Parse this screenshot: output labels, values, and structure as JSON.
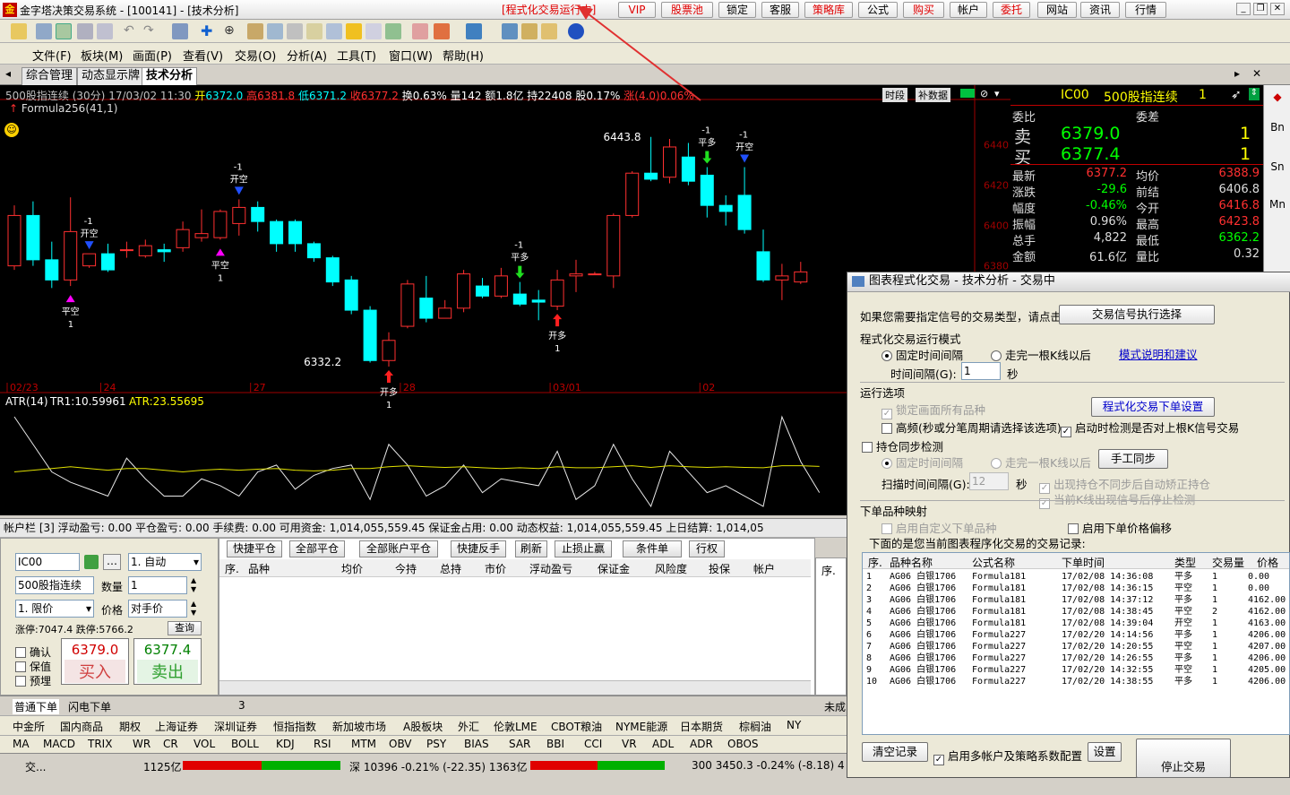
{
  "window": {
    "title": "金字塔决策交易系统 - [100141] - [技术分析]",
    "run_status": "[程式化交易运行中]",
    "app_icon": "金"
  },
  "top_buttons": [
    {
      "label": "VIP",
      "red": true
    },
    {
      "label": "股票池",
      "red": true
    },
    {
      "label": "锁定",
      "red": false
    },
    {
      "label": "客服",
      "red": false
    },
    {
      "label": "策略库",
      "red": true
    },
    {
      "label": "公式",
      "red": false
    },
    {
      "label": "购买",
      "red": true
    },
    {
      "label": "帐户",
      "red": false
    },
    {
      "label": "委托",
      "red": true
    },
    {
      "label": "网站",
      "red": false
    },
    {
      "label": "资讯",
      "red": false
    },
    {
      "label": "行情",
      "red": false
    }
  ],
  "menu": [
    "文件(F)",
    "板块(M)",
    "画面(P)",
    "查看(V)",
    "交易(O)",
    "分析(A)",
    "工具(T)",
    "窗口(W)",
    "帮助(H)"
  ],
  "tabs": [
    "综合管理",
    "动态显示牌",
    "技术分析"
  ],
  "chart_info": {
    "name": "500股指连续 (30分)",
    "date": "17/03/02 11:30",
    "open_label": "开",
    "open": "6372.0",
    "high_label": "高",
    "high": "6381.8",
    "low_label": "低",
    "low": "6371.2",
    "close_label": "收",
    "close": "6377.2",
    "turnover": "换0.63%",
    "volume": "量142",
    "amount": "额1.8亿",
    "hold": "持22408",
    "rise": "股0.17%",
    "change": "涨(4.0)0.06%",
    "formula": "Formula256(41,1)",
    "btn_period": "时段",
    "btn_fill": "补数据"
  },
  "chart_data": {
    "type": "candlestick",
    "title": "500股指连续 (30分)",
    "x": [
      "02/23",
      "24",
      "27",
      "28",
      "03/01",
      "02"
    ],
    "ylim": [
      6320,
      6450
    ],
    "y_ticks": [
      6440,
      6420,
      6400,
      6380
    ],
    "candles": [
      [
        6380,
        6405,
        6410,
        6378
      ],
      [
        6405,
        6383,
        6412,
        6380
      ],
      [
        6383,
        6373,
        6392,
        6369
      ],
      [
        6373,
        6397,
        6414,
        6370
      ],
      [
        6380,
        6386,
        6386,
        6379
      ],
      [
        6386,
        6378,
        6391,
        6377
      ],
      [
        6388,
        6388,
        6392,
        6384
      ],
      [
        6385,
        6390,
        6393,
        6384
      ],
      [
        6388,
        6387,
        6391,
        6382
      ],
      [
        6389,
        6398,
        6402,
        6387
      ],
      [
        6394,
        6396,
        6408,
        6392
      ],
      [
        6394,
        6407,
        6408,
        6393
      ],
      [
        6401,
        6409,
        6413,
        6395
      ],
      [
        6409,
        6402,
        6412,
        6397
      ],
      [
        6402,
        6391,
        6403,
        6387
      ],
      [
        6402,
        6391,
        6403,
        6387
      ],
      [
        6391,
        6384,
        6392,
        6382
      ],
      [
        6384,
        6372,
        6385,
        6370
      ],
      [
        6373,
        6358,
        6375,
        6356
      ],
      [
        6358,
        6333,
        6360,
        6332
      ],
      [
        6333,
        6343,
        6347,
        6330
      ],
      [
        6350,
        6371,
        6373,
        6349
      ],
      [
        6364,
        6354,
        6375,
        6352
      ],
      [
        6354,
        6359,
        6363,
        6354
      ],
      [
        6359,
        6376,
        6378,
        6357
      ],
      [
        6370,
        6365,
        6374,
        6364
      ],
      [
        6365,
        6375,
        6379,
        6364
      ],
      [
        6366,
        6361,
        6372,
        6360
      ],
      [
        6363,
        6362,
        6368,
        6353
      ],
      [
        6360,
        6373,
        6378,
        6358
      ],
      [
        6375,
        6376,
        6383,
        6367
      ],
      [
        6376,
        6376,
        6377,
        6376
      ],
      [
        6375,
        6405,
        6406,
        6369
      ],
      [
        6405,
        6426,
        6427,
        6404
      ],
      [
        6426,
        6423,
        6444,
        6422
      ],
      [
        6424,
        6439,
        6443,
        6421
      ],
      [
        6434,
        6422,
        6441,
        6420
      ],
      [
        6425,
        6410,
        6429,
        6404
      ],
      [
        6410,
        6407,
        6415,
        6400
      ],
      [
        6415,
        6398,
        6429,
        6396
      ],
      [
        6387,
        6373,
        6398,
        6372
      ],
      [
        6373,
        6375,
        6381,
        6363
      ],
      [
        6372,
        6377,
        6382,
        6371
      ]
    ],
    "signals": [
      {
        "i": 3,
        "text": "平空",
        "qty": "1",
        "type": "buy_close"
      },
      {
        "i": 4,
        "text": "开空",
        "qty": "-1",
        "type": "sell_open"
      },
      {
        "i": 11,
        "text": "平空",
        "qty": "1",
        "type": "buy_close"
      },
      {
        "i": 12,
        "text": "开空",
        "qty": "-1",
        "type": "sell_open"
      },
      {
        "i": 20,
        "text": "开多",
        "qty": "1",
        "type": "buy_open"
      },
      {
        "i": 27,
        "text": "平多",
        "qty": "-1",
        "type": "sell_close"
      },
      {
        "i": 29,
        "text": "开多",
        "qty": "1",
        "type": "buy_open"
      },
      {
        "i": 37,
        "text": "平多",
        "qty": "-1",
        "type": "sell_close"
      },
      {
        "i": 39,
        "text": "开空",
        "qty": "-1",
        "type": "sell_open"
      }
    ],
    "annotations": [
      {
        "i": 35,
        "text": "6443.8",
        "at": 6443.8
      },
      {
        "i": 19,
        "text": "6332.2",
        "at": 6332.2
      }
    ],
    "atr": {
      "label": "ATR(14)",
      "tr_label": "TR1:10.59961",
      "atr_label": "ATR:23.55695",
      "tr": [
        28,
        20,
        12,
        9,
        7,
        5,
        16,
        10,
        5,
        5,
        10,
        8,
        5,
        12,
        14,
        7,
        11,
        13,
        14,
        4,
        20,
        14,
        5,
        8,
        14,
        6,
        10,
        9,
        8,
        18,
        4,
        8,
        20,
        10,
        2,
        18,
        12,
        6,
        8,
        5,
        2,
        28,
        15,
        6
      ],
      "atr_line": [
        12,
        12.5,
        13,
        13.5,
        13,
        12.5,
        13,
        13,
        12.5,
        12,
        12.5,
        12.8,
        12.5,
        12.8,
        13,
        12.5,
        12.3,
        12.5,
        13,
        13,
        13.5,
        13.8,
        13.5,
        13.3,
        13.5,
        13.2,
        13,
        13.2,
        13,
        13.5,
        13.2,
        13.2,
        13.5,
        13.8,
        13.3,
        13.8,
        13.5,
        13.3,
        13.5,
        13.3,
        13.2,
        13.8,
        13.8,
        13.6
      ]
    }
  },
  "quote": {
    "header_code": "IC00",
    "header_name": "500股指连续",
    "header_num": "1",
    "weibi": "委比",
    "weicha": "委差",
    "sell_label": "卖",
    "sell_price": "6379.0",
    "sell_qty": "1",
    "buy_label": "买",
    "buy_price": "6377.4",
    "buy_qty": "1",
    "rows": [
      [
        "最新",
        "6377.2",
        "均价",
        "6388.9"
      ],
      [
        "涨跌",
        "-29.6",
        "前结",
        "6406.8"
      ],
      [
        "幅度",
        "-0.46%",
        "今开",
        "6416.8"
      ],
      [
        "振幅",
        "0.96%",
        "最高",
        "6423.8"
      ],
      [
        "总手",
        "4,822",
        "最低",
        "6362.2"
      ],
      [
        "金额",
        "61.6亿",
        "量比",
        "0.32"
      ]
    ]
  },
  "side_tabs": [
    "Bn",
    "Sn",
    "Mn"
  ],
  "account_bar": "帐户栏 [3]  浮动盈亏: 0.00   平仓盈亏: 0.00   手续费: 0.00   可用资金: 1,014,055,559.45   保证金占用: 0.00   动态权益: 1,014,055,559.45   上日结算: 1,014,05",
  "order": {
    "code": "IC00",
    "name": "500股指连续",
    "mode": "1. 自动",
    "qty_label": "数量",
    "qty": "1",
    "price_type": "1. 限价",
    "price_label": "价格",
    "price": "对手价",
    "limit": "涨停:7047.4 跌停:5766.2",
    "query": "查询",
    "confirm": "确认",
    "guarantee": "保值",
    "preset": "预埋",
    "buy_price": "6379.0",
    "buy_label": "买入",
    "sell_price": "6377.4",
    "sell_label": "卖出"
  },
  "actions": [
    "快捷平仓",
    "全部平仓",
    "全部账户平仓",
    "快捷反手",
    "刷新",
    "止损止赢",
    "条件单",
    "行权"
  ],
  "pos_headers": [
    "序.",
    "品种",
    "均价",
    "今持",
    "总持",
    "市价",
    "浮动盈亏",
    "保证金",
    "风险度",
    "投保",
    "帐户"
  ],
  "right_header": "序.",
  "bottom_tabs": [
    "普通下单",
    "闪电下单"
  ],
  "page_num": "3",
  "unfilled_tab": "未成",
  "markets": [
    "中金所",
    "国内商品",
    "期权",
    "上海证券",
    "深圳证券",
    "恒指指数",
    "新加坡市场",
    "A股板块",
    "外汇",
    "伦敦LME",
    "CBOT粮油",
    "NYME能源",
    "日本期货",
    "棕榈油",
    "NY"
  ],
  "indicators": [
    "MA",
    "MACD",
    "TRIX",
    "WR",
    "CR",
    "VOL",
    "BOLL",
    "KDJ",
    "RSI",
    "MTM",
    "OBV",
    "PSY",
    "BIAS",
    "SAR",
    "BBI",
    "CCI",
    "VR",
    "ADL",
    "ADR",
    "OBOS"
  ],
  "status": {
    "left": "交...",
    "sh_amount": "1125亿",
    "sz": "深 10396 -0.21% (-22.35) 1363亿",
    "s300": "300 3450.3 -0.24% (-8.18) 4"
  },
  "dialog": {
    "title": "图表程式化交易 - 技术分析 - 交易中",
    "intro": "如果您需要指定信号的交易类型，请点击",
    "btn_signal": "交易信号执行选择",
    "mode_title": "程式化交易运行模式",
    "mode_fixed": "固定时间间隔",
    "mode_kline": "走完一根K线以后",
    "mode_link": "模式说明和建议",
    "interval_label": "时间间隔(G):",
    "interval": "1",
    "sec": "秒",
    "run_title": "运行选项",
    "lock_all": "锁定画面所有品种",
    "btn_order_set": "程式化交易下单设置",
    "hf": "高频(秒或分笔周期请选择该选项)",
    "startup_check": "启动时检测是否对上根K信号交易",
    "sync_title": "持仓同步检测",
    "sync_fixed": "固定时间间隔",
    "sync_kline": "走完一根K线以后",
    "btn_manual": "手工同步",
    "scan_label": "扫描时间间隔(G):",
    "scan": "12",
    "scan_sec": "秒",
    "auto_fix": "出现持仓不同步后自动矫正持仓",
    "stop_detect": "当前K线出现信号后停止检测",
    "map_title": "下单品种映射",
    "custom_var": "启用自定义下单品种",
    "price_offset": "启用下单价格偏移",
    "log_title": "下面的是您当前图表程序化交易的交易记录:",
    "log_headers": [
      "序.",
      "品种名称",
      "公式名称",
      "下单时间",
      "类型",
      "交易量",
      "价格"
    ],
    "log_rows": [
      [
        "1",
        "AG06 白银1706",
        "Formula181",
        "17/02/08 14:36:08",
        "平多",
        "1",
        "0.00"
      ],
      [
        "2",
        "AG06 白银1706",
        "Formula181",
        "17/02/08 14:36:15",
        "平空",
        "1",
        "0.00"
      ],
      [
        "3",
        "AG06 白银1706",
        "Formula181",
        "17/02/08 14:37:12",
        "平多",
        "1",
        "4162.00"
      ],
      [
        "4",
        "AG06 白银1706",
        "Formula181",
        "17/02/08 14:38:45",
        "平空",
        "2",
        "4162.00"
      ],
      [
        "5",
        "AG06 白银1706",
        "Formula181",
        "17/02/08 14:39:04",
        "开空",
        "1",
        "4163.00"
      ],
      [
        "6",
        "AG06 白银1706",
        "Formula227",
        "17/02/20 14:14:56",
        "平多",
        "1",
        "4206.00"
      ],
      [
        "7",
        "AG06 白银1706",
        "Formula227",
        "17/02/20 14:20:55",
        "平空",
        "1",
        "4207.00"
      ],
      [
        "8",
        "AG06 白银1706",
        "Formula227",
        "17/02/20 14:26:55",
        "平多",
        "1",
        "4206.00"
      ],
      [
        "9",
        "AG06 白银1706",
        "Formula227",
        "17/02/20 14:32:55",
        "平空",
        "1",
        "4205.00"
      ],
      [
        "10",
        "AG06 白银1706",
        "Formula227",
        "17/02/20 14:38:55",
        "平多",
        "1",
        "4206.00"
      ]
    ],
    "btn_clear": "清空记录",
    "multi": "启用多帐户及策略系数配置",
    "btn_settings": "设置",
    "btn_stop": "停止交易"
  }
}
